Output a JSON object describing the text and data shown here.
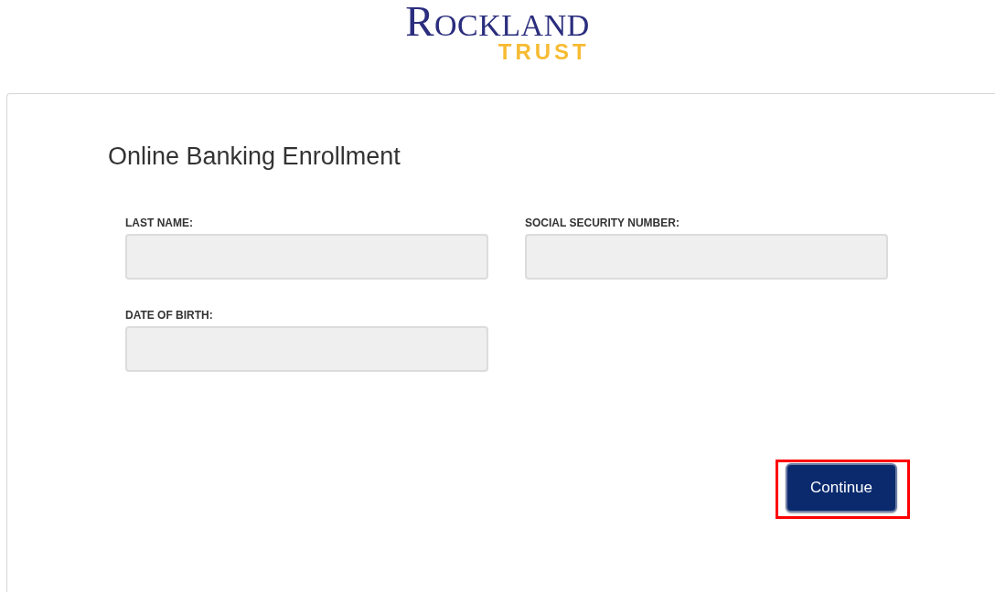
{
  "logo": {
    "name": "ROCKLAND",
    "tagline": "TRUST"
  },
  "form": {
    "title": "Online Banking Enrollment",
    "fields": [
      {
        "label": "LAST NAME:"
      },
      {
        "label": "SOCIAL SECURITY NUMBER:"
      },
      {
        "label": "DATE OF BIRTH:"
      }
    ],
    "continue_button": {
      "label": "Continue",
      "highlighted": true
    }
  }
}
